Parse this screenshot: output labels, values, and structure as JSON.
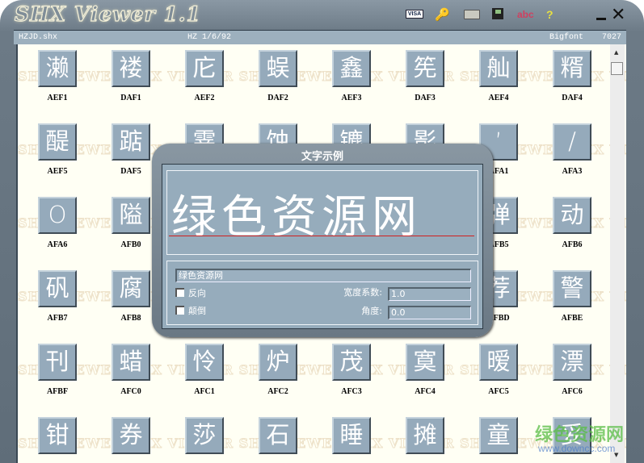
{
  "app": {
    "title": "SHX Viewer 1.1"
  },
  "toolbar": {
    "visa": "VISA",
    "abc": "abc",
    "help": "?",
    "key": "key-icon",
    "close": "✕"
  },
  "info": {
    "file": "HZJD.shx",
    "font_id": "HZ 1/6/92",
    "type": "Bigfont",
    "count": "7027"
  },
  "watermark": "SHX VIEWER SHX VIEWER SHX VIEWER SHX VIEWER SHX VIEWER SHX VIEWER",
  "tiles": [
    {
      "char": "濑",
      "code": "AEF1"
    },
    {
      "char": "褛",
      "code": "DAF1"
    },
    {
      "char": "庀",
      "code": "AEF2"
    },
    {
      "char": "蜈",
      "code": "DAF2"
    },
    {
      "char": "鑫",
      "code": "AEF3"
    },
    {
      "char": "筅",
      "code": "DAF3"
    },
    {
      "char": "舢",
      "code": "AEF4"
    },
    {
      "char": "糈",
      "code": "DAF4"
    },
    {
      "char": "醍",
      "code": "AEF5"
    },
    {
      "char": "踮",
      "code": "DAF5"
    },
    {
      "char": "霎",
      "code": ""
    },
    {
      "char": "蚀",
      "code": ""
    },
    {
      "char": "镳",
      "code": ""
    },
    {
      "char": "影",
      "code": ""
    },
    {
      "char": "’",
      "code": "AFA1"
    },
    {
      "char": "/",
      "code": "AFA3"
    },
    {
      "char": "O",
      "code": "AFA6"
    },
    {
      "char": "隘",
      "code": "AFB0"
    },
    {
      "char": "",
      "code": ""
    },
    {
      "char": "",
      "code": ""
    },
    {
      "char": "",
      "code": ""
    },
    {
      "char": "",
      "code": ""
    },
    {
      "char": "弹",
      "code": "AFB5"
    },
    {
      "char": "动",
      "code": "AFB6"
    },
    {
      "char": "矾",
      "code": "AFB7"
    },
    {
      "char": "腐",
      "code": "AFB8"
    },
    {
      "char": "",
      "code": ""
    },
    {
      "char": "",
      "code": ""
    },
    {
      "char": "",
      "code": ""
    },
    {
      "char": "",
      "code": ""
    },
    {
      "char": "荐",
      "code": "AFBD"
    },
    {
      "char": "警",
      "code": "AFBE"
    },
    {
      "char": "刊",
      "code": "AFBF"
    },
    {
      "char": "蜡",
      "code": "AFC0"
    },
    {
      "char": "怜",
      "code": "AFC1"
    },
    {
      "char": "炉",
      "code": "AFC2"
    },
    {
      "char": "茂",
      "code": "AFC3"
    },
    {
      "char": "寞",
      "code": "AFC4"
    },
    {
      "char": "暧",
      "code": "AFC5"
    },
    {
      "char": "漂",
      "code": "AFC6"
    },
    {
      "char": "钳",
      "code": ""
    },
    {
      "char": "券",
      "code": ""
    },
    {
      "char": "莎",
      "code": ""
    },
    {
      "char": "石",
      "code": ""
    },
    {
      "char": "睡",
      "code": ""
    },
    {
      "char": "摊",
      "code": ""
    },
    {
      "char": "童",
      "code": ""
    },
    {
      "char": "妥",
      "code": ""
    }
  ],
  "dialog": {
    "title": "文字示例",
    "preview": "绿色资源网",
    "text_value": "绿色资源网",
    "reverse_label": "反向",
    "upside_label": "颠倒",
    "reverse_checked": false,
    "upside_checked": false,
    "width_label": "宽度系数:",
    "width_value": "1.0",
    "angle_label": "角度:",
    "angle_value": "0.0"
  },
  "site_watermark": {
    "name": "绿色资源网",
    "url": "www.downcc.com"
  }
}
